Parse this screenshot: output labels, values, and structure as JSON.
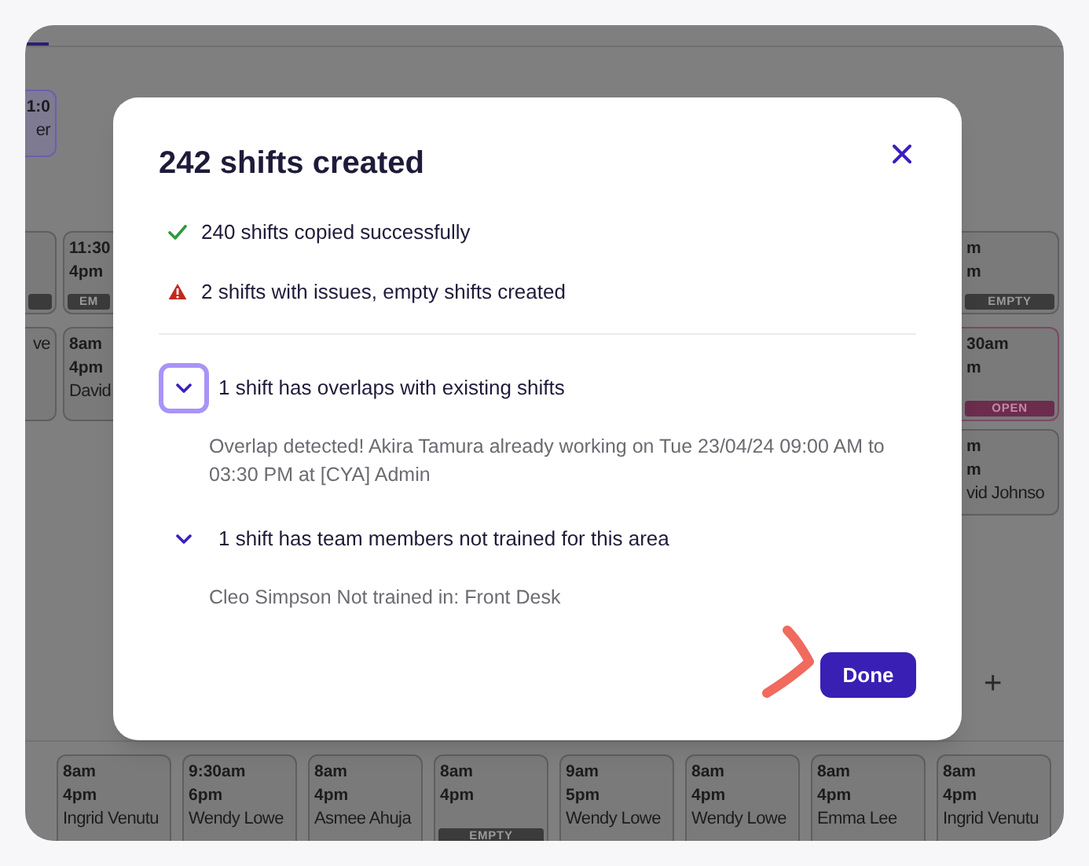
{
  "schedule": {
    "left_narrow_cards": [
      {
        "lines": [
          "1:0"
        ],
        "name": "er"
      },
      {
        "badge": {
          "kind": "empty"
        }
      },
      {
        "name": "ve"
      }
    ],
    "left_cards": [
      {
        "lines": [
          "11:30",
          "4pm"
        ],
        "badge": {
          "text": "EM",
          "kind": "empty"
        }
      },
      {
        "lines": [
          "8am",
          "4pm"
        ],
        "name": "David"
      }
    ],
    "right_cards": [
      {
        "lines": [
          "m",
          "m"
        ],
        "badge": {
          "text": "EMPTY",
          "kind": "empty"
        }
      },
      {
        "lines": [
          "30am",
          "m"
        ],
        "badge": {
          "text": "OPEN",
          "kind": "open"
        }
      },
      {
        "lines": [
          "m",
          "m"
        ],
        "name": "vid Johnso"
      }
    ],
    "add_label": "+",
    "bottom_cards": [
      {
        "lines": [
          "8am",
          "4pm"
        ],
        "name": "Ingrid Venutu"
      },
      {
        "lines": [
          "9:30am",
          "6pm"
        ],
        "name": "Wendy Lowe"
      },
      {
        "lines": [
          "8am",
          "4pm"
        ],
        "name": "Asmee Ahuja"
      },
      {
        "lines": [
          "8am",
          "4pm"
        ],
        "badge": {
          "text": "EMPTY",
          "kind": "empty"
        }
      },
      {
        "lines": [
          "9am",
          "5pm"
        ],
        "name": "Wendy Lowe"
      },
      {
        "lines": [
          "8am",
          "4pm"
        ],
        "name": "Wendy Lowe"
      },
      {
        "lines": [
          "8am",
          "4pm"
        ],
        "name": "Emma Lee"
      },
      {
        "lines": [
          "8am",
          "4pm"
        ],
        "name": "Ingrid Venutu"
      }
    ]
  },
  "dialog": {
    "title": "242 shifts created",
    "results": [
      {
        "kind": "success",
        "text": "240 shifts copied successfully"
      },
      {
        "kind": "warning",
        "text": "2 shifts with issues, empty shifts created"
      }
    ],
    "issues": [
      {
        "title": "1 shift has overlaps with existing shifts",
        "expanded": true,
        "focused": true,
        "detail": "Overlap detected! Akira Tamura already working on Tue 23/04/24 09:00 AM to 03:30 PM at [CYA] Admin"
      },
      {
        "title": "1 shift has team members not trained for this area",
        "expanded": true,
        "focused": false,
        "detail": "Cleo Simpson Not trained in: Front Desk"
      }
    ],
    "done_button": "Done"
  }
}
